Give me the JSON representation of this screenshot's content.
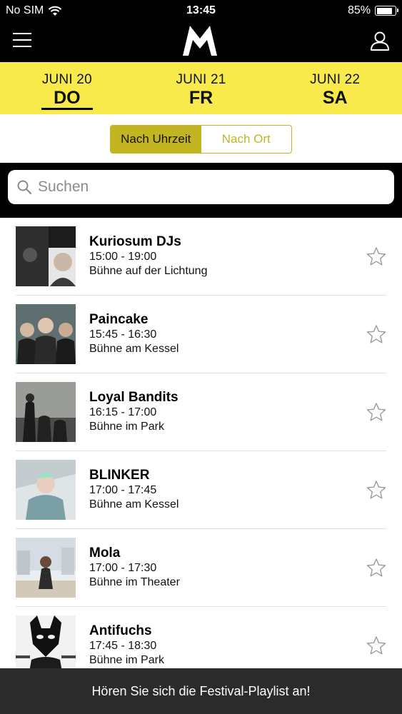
{
  "status_bar": {
    "carrier": "No SIM",
    "time": "13:45",
    "battery": "85%",
    "battery_level": 0.85
  },
  "nav": {
    "menu_icon": "hamburger-menu-icon",
    "logo_icon": "m-logo-icon",
    "profile_icon": "user-profile-icon"
  },
  "dates": [
    {
      "month": "JUNI 20",
      "day": "DO",
      "active": true
    },
    {
      "month": "JUNI 21",
      "day": "FR",
      "active": false
    },
    {
      "month": "JUNI 22",
      "day": "SA",
      "active": false
    }
  ],
  "sort": {
    "by_time": "Nach Uhrzeit",
    "by_place": "Nach Ort",
    "selected": "by_time"
  },
  "search": {
    "placeholder": "Suchen",
    "value": ""
  },
  "acts": [
    {
      "name": "Kuriosum DJs",
      "time": "15:00 - 19:00",
      "stage": "Bühne auf der Lichtung",
      "favorite": false
    },
    {
      "name": "Paincake",
      "time": "15:45 - 16:30",
      "stage": "Bühne am Kessel",
      "favorite": false
    },
    {
      "name": "Loyal Bandits",
      "time": "16:15 - 17:00",
      "stage": "Bühne im Park",
      "favorite": false
    },
    {
      "name": "BLINKER",
      "time": "17:00 - 17:45",
      "stage": "Bühne am Kessel",
      "favorite": false
    },
    {
      "name": "Mola",
      "time": "17:00 - 17:30",
      "stage": "Bühne im Theater",
      "favorite": false
    },
    {
      "name": "Antifuchs",
      "time": "17:45 - 18:30",
      "stage": "Bühne im Park",
      "favorite": false
    }
  ],
  "footer": {
    "playlist_label": "Hören Sie sich die Festival-Playlist an!"
  },
  "colors": {
    "accent_yellow": "#f7ea4a",
    "segment_olive": "#c2b521",
    "bar_black": "#000000",
    "footer_dark": "#2b2b2b"
  }
}
